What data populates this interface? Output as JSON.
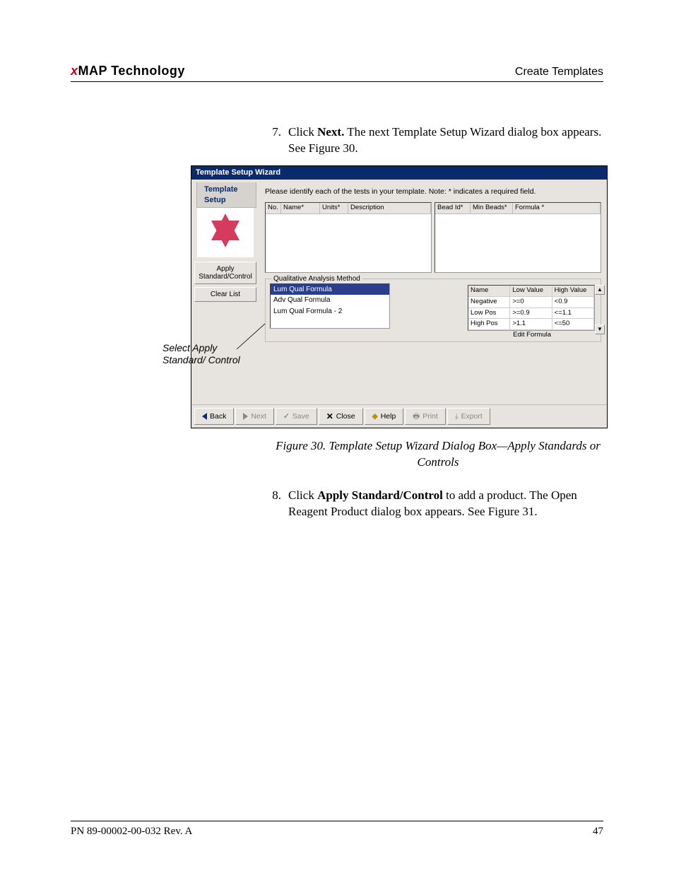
{
  "header": {
    "brand_x": "x",
    "brand_rest": "MAP  Technology",
    "section": "Create Templates"
  },
  "step7": {
    "num": "7.",
    "pre": "Click ",
    "bold": "Next.",
    "post": " The next Template Setup Wizard dialog box appears. See Figure 30."
  },
  "callout": "Select Apply Standard/ Control",
  "wizard": {
    "title": "Template Setup Wizard",
    "subtitle": "Template Setup",
    "instruction": "Please identify each of the tests in your template.  Note: * indicates a required field.",
    "side": {
      "apply": "Apply Standard/Control",
      "clear": "Clear List"
    },
    "grid_left_headers": [
      "No.",
      "Name*",
      "Units*",
      "Description"
    ],
    "grid_right_headers": [
      "Bead Id*",
      "Min Beads*",
      "Formula *"
    ],
    "qual_legend": "Qualitative Analysis Method",
    "methods": [
      "Lum Qual Formula",
      "Adv Qual Formula",
      "Lum Qual Formula - 2"
    ],
    "val_head": [
      "Name",
      "Low Value",
      "High Value"
    ],
    "val_rows": [
      [
        "Negative",
        ">=0",
        "<0.9"
      ],
      [
        "Low Pos",
        ">=0.9",
        "<=1.1"
      ],
      [
        "High Pos",
        ">1.1",
        "<=50"
      ]
    ],
    "edit": "Edit Formula",
    "footer": {
      "back": "Back",
      "next": "Next",
      "save": "Save",
      "close": "Close",
      "help": "Help",
      "print": "Print",
      "export": "Export"
    }
  },
  "fig30": "Figure 30.  Template Setup Wizard Dialog Box—Apply Standards or Controls",
  "step8": {
    "num": "8.",
    "pre": "Click ",
    "bold": "Apply Standard/Control",
    "post": " to add a product. The Open Reagent Product dialog box appears. See Figure 31."
  },
  "footer": {
    "left": "PN 89-00002-00-032 Rev. A",
    "right": "47"
  }
}
